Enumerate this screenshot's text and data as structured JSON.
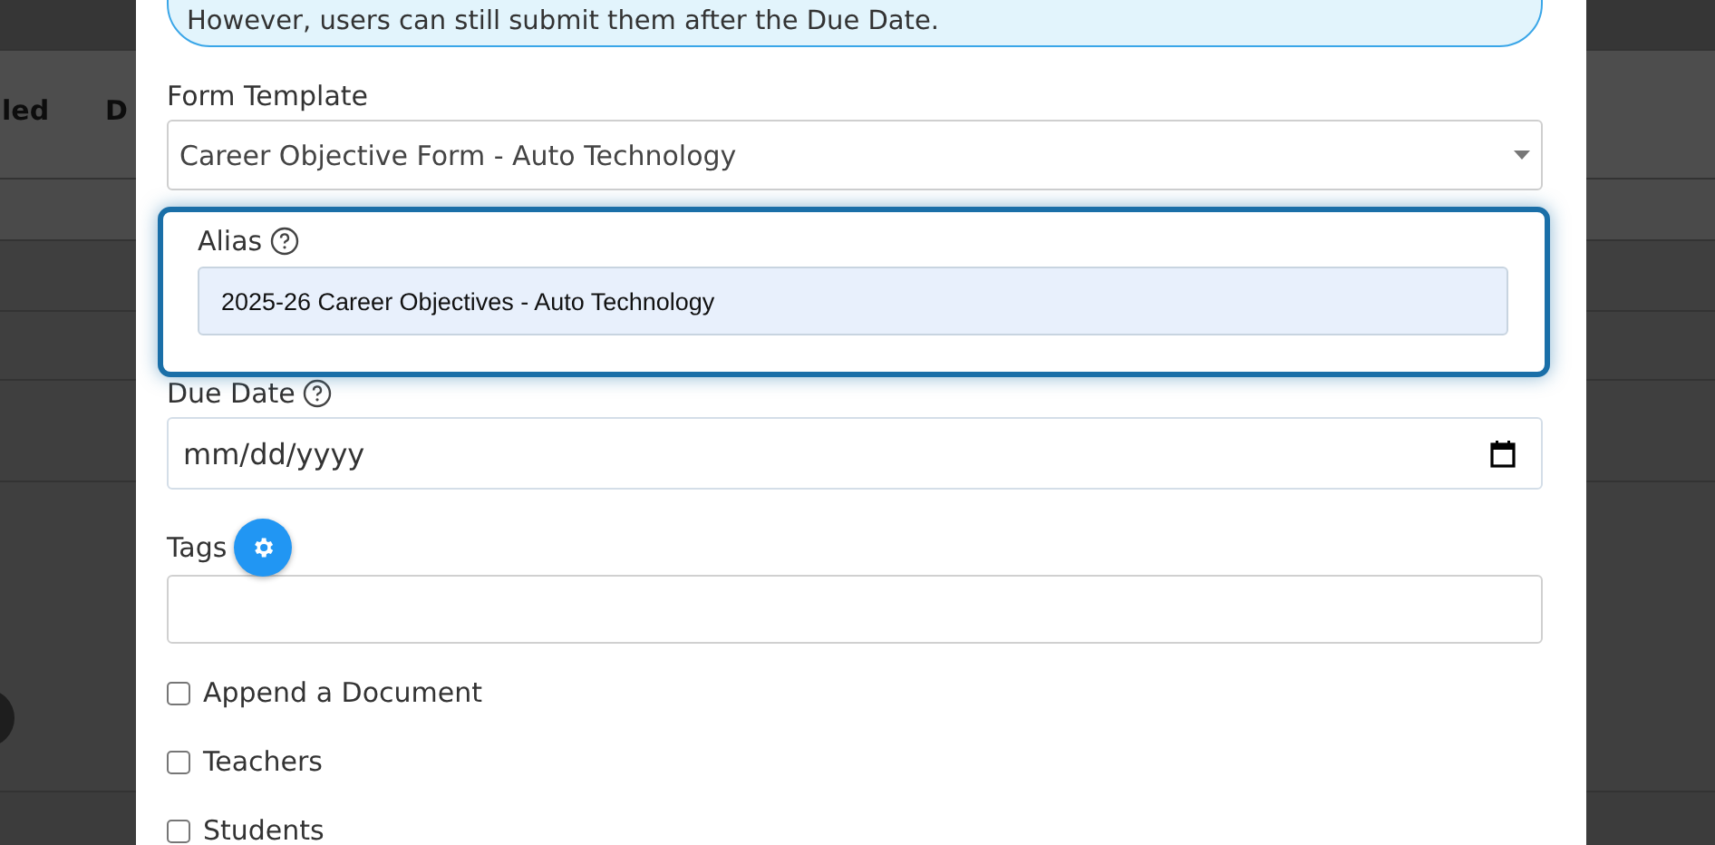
{
  "background_table": {
    "column_headers": [
      "led",
      "D"
    ]
  },
  "modal": {
    "notice": "However, users can still submit them after the Due Date.",
    "form_template": {
      "label": "Form Template",
      "value": "Career Objective Form - Auto Technology"
    },
    "alias": {
      "label": "Alias",
      "value": "2025-26 Career Objectives - Auto Technology"
    },
    "due_date": {
      "label": "Due Date",
      "placeholder": "mm/dd/yyyy"
    },
    "tags": {
      "label": "Tags"
    },
    "options": [
      {
        "label": "Append a Document",
        "checked": false
      },
      {
        "label": "Teachers",
        "checked": false
      },
      {
        "label": "Students",
        "checked": false
      }
    ]
  }
}
